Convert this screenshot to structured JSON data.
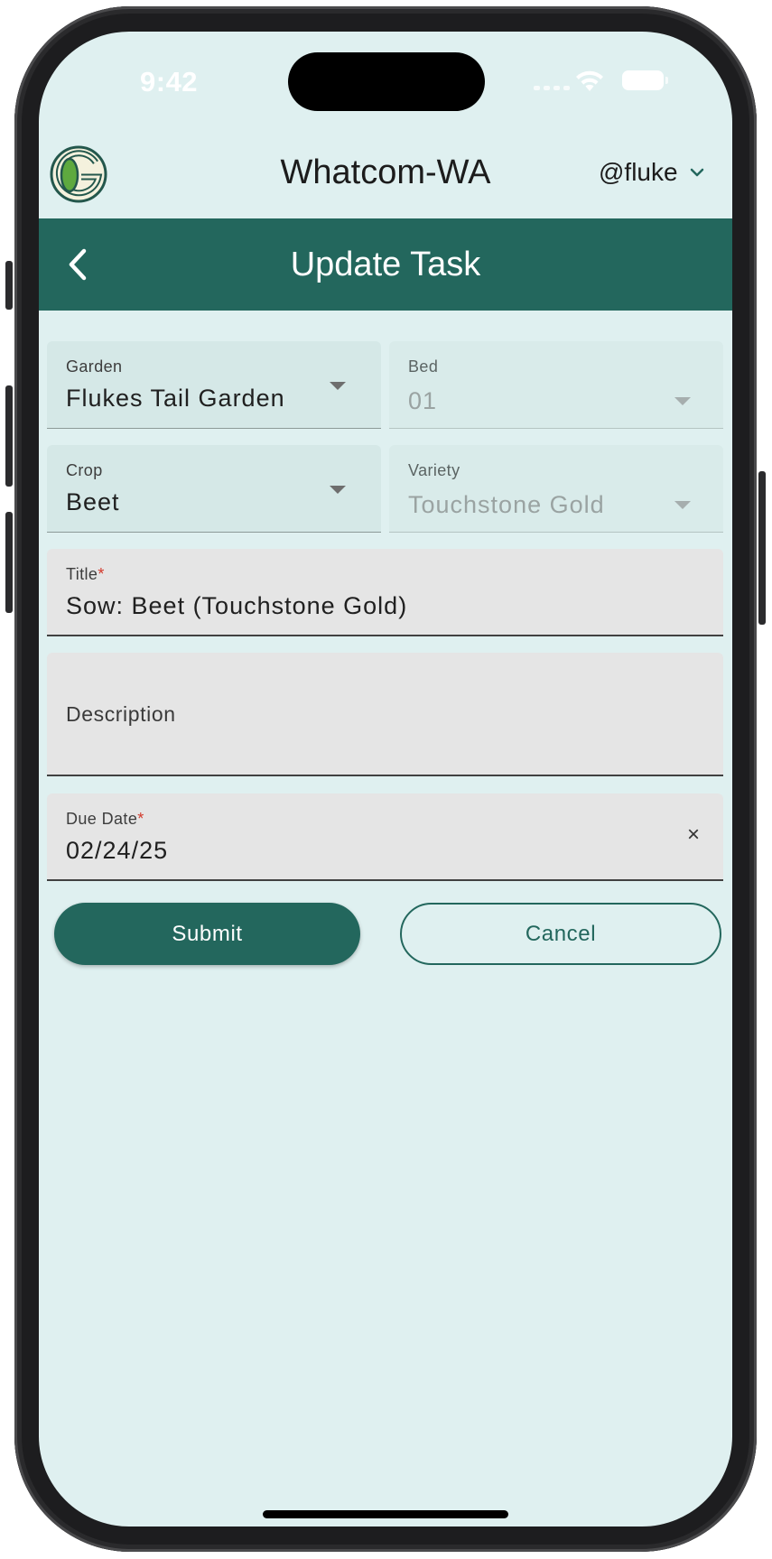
{
  "status_bar": {
    "time": "9:42"
  },
  "header": {
    "region": "Whatcom-WA",
    "user": "@fluke"
  },
  "app_bar": {
    "title": "Update Task"
  },
  "form": {
    "garden": {
      "label": "Garden",
      "value": "Flukes Tail Garden"
    },
    "bed": {
      "label": "Bed",
      "value": "01"
    },
    "crop": {
      "label": "Crop",
      "value": "Beet"
    },
    "variety": {
      "label": "Variety",
      "value": "Touchstone Gold"
    },
    "title": {
      "label": "Title",
      "required_mark": "*",
      "value": "Sow: Beet (Touchstone Gold)"
    },
    "description": {
      "label": "Description",
      "value": ""
    },
    "due_date": {
      "label": "Due Date",
      "required_mark": "*",
      "value": "02/24/25",
      "clear_glyph": "×"
    }
  },
  "buttons": {
    "submit_label": "Submit",
    "cancel_label": "Cancel"
  },
  "colors": {
    "primary": "#23675d",
    "background": "#dff0f0",
    "required": "#d33a2c"
  },
  "icons": [
    "logo-icon",
    "wifi-icon",
    "battery-icon",
    "chevron-down-icon",
    "back-arrow-icon",
    "dropdown-caret-icon",
    "clear-icon"
  ]
}
